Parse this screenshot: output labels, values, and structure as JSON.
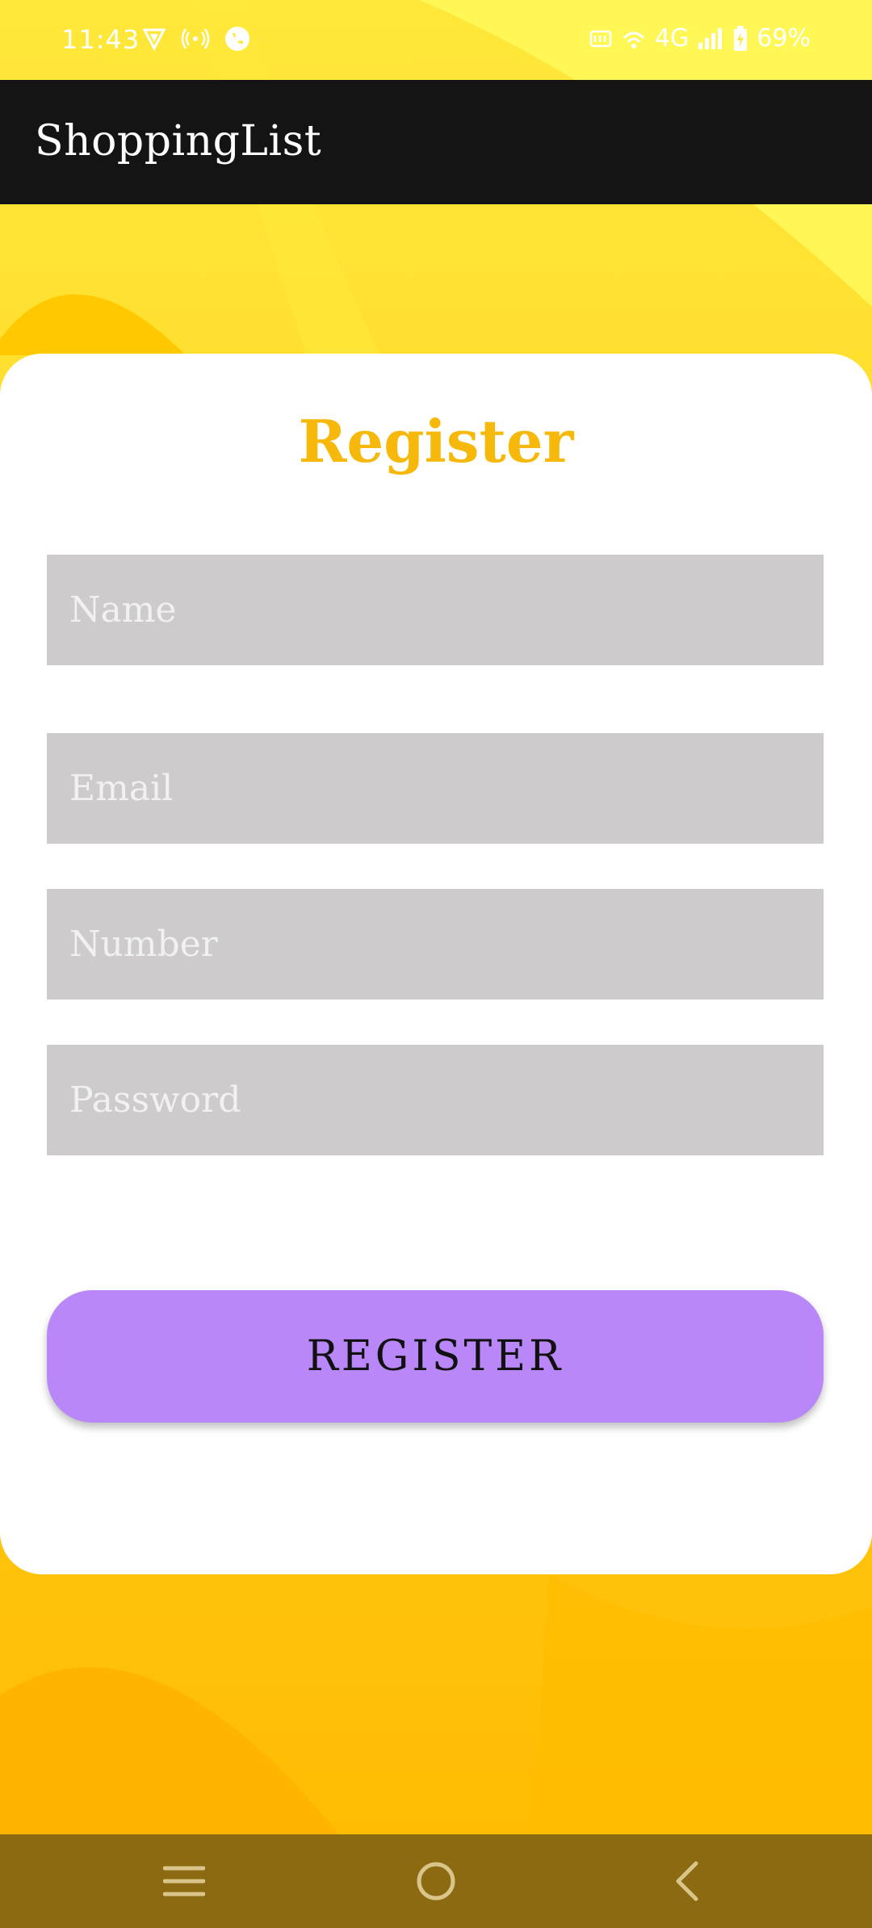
{
  "status_bar": {
    "time": "11:43",
    "network": "4G",
    "battery": "69%"
  },
  "app_bar": {
    "title": "ShoppingList"
  },
  "form": {
    "title": "Register",
    "fields": [
      {
        "placeholder": "Name",
        "value": ""
      },
      {
        "placeholder": "Email",
        "value": ""
      },
      {
        "placeholder": "Number",
        "value": ""
      },
      {
        "placeholder": "Password",
        "value": ""
      }
    ],
    "submit_label": "REGISTER"
  },
  "nav_bar": {
    "icons": [
      "menu-icon",
      "home-icon",
      "back-icon"
    ]
  },
  "colors": {
    "accent": "#f6b80a",
    "button": "#b987f8",
    "field": "#cdcbcc",
    "app_bar": "#141414",
    "nav_bar": "#8c6a12"
  }
}
